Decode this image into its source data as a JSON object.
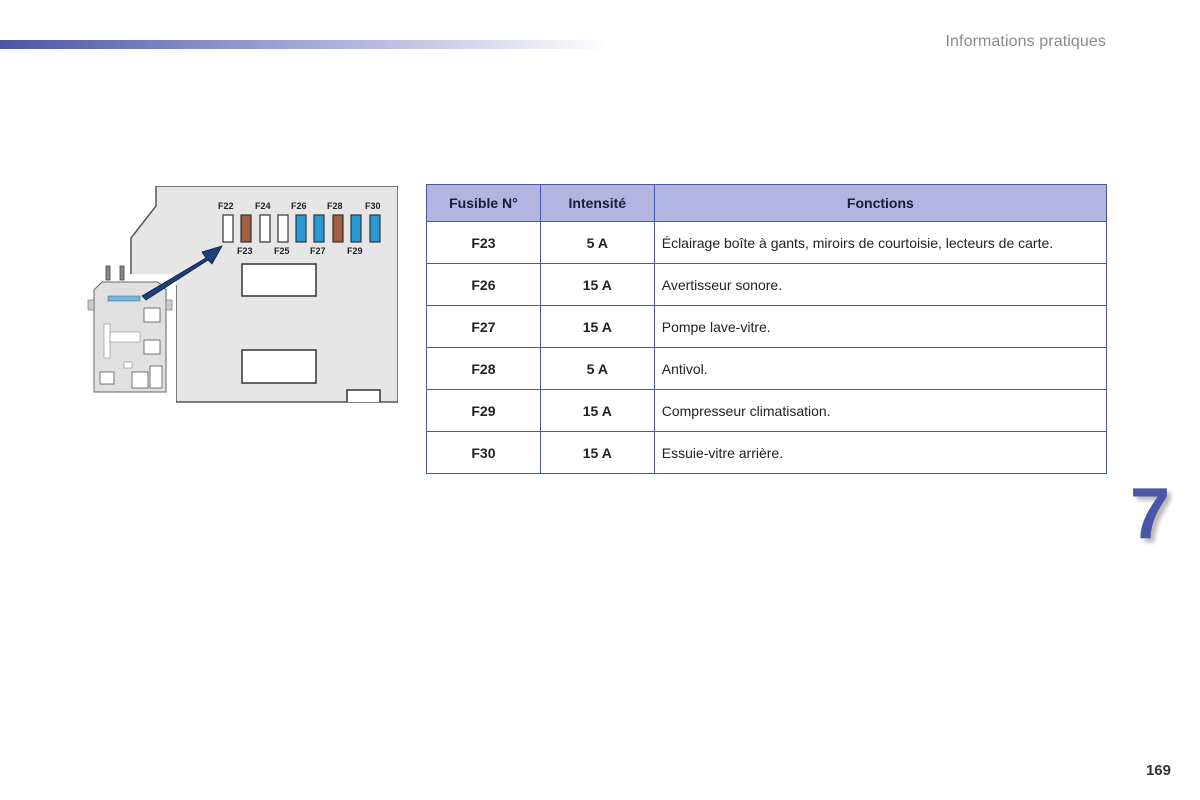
{
  "header": {
    "section_title": "Informations pratiques",
    "accent_color": "#4a56a8"
  },
  "figure": {
    "top_labels": [
      "F22",
      "F24",
      "F26",
      "F28",
      "F30"
    ],
    "bottom_labels": [
      "F23",
      "F25",
      "F27",
      "F29"
    ],
    "fuse_colors": {
      "white": "#ffffff",
      "brown": "#a0603f",
      "blue": "#2a9ad6"
    }
  },
  "table": {
    "headers": [
      "Fusible N°",
      "Intensité",
      "Fonctions"
    ],
    "rows": [
      {
        "fuse": "F23",
        "amp": "5 A",
        "function": "Éclairage boîte à gants, miroirs de courtoisie, lecteurs de carte."
      },
      {
        "fuse": "F26",
        "amp": "15 A",
        "function": "Avertisseur sonore."
      },
      {
        "fuse": "F27",
        "amp": "15 A",
        "function": "Pompe lave-vitre."
      },
      {
        "fuse": "F28",
        "amp": "5 A",
        "function": "Antivol."
      },
      {
        "fuse": "F29",
        "amp": "15 A",
        "function": "Compresseur climatisation."
      },
      {
        "fuse": "F30",
        "amp": "15 A",
        "function": "Essuie-vitre arrière."
      }
    ]
  },
  "chapter_number": "7",
  "page_number": "169"
}
